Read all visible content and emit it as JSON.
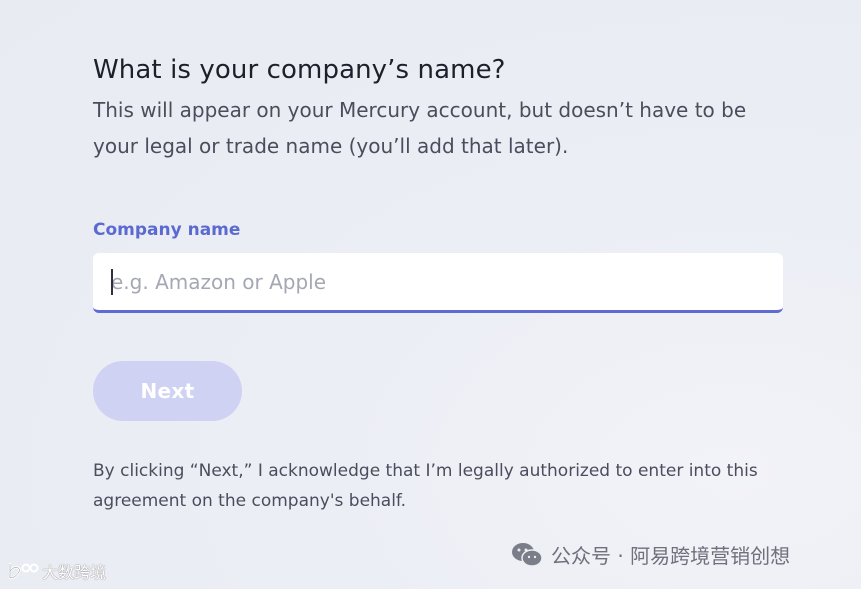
{
  "form": {
    "title": "What is your company’s name?",
    "subtitle": "This will appear on your Mercury account, but doesn’t have to be your legal or trade name (you’ll add that later).",
    "company_name_label": "Company name",
    "company_name_value": "",
    "company_name_placeholder": "e.g. Amazon or Apple",
    "next_label": "Next",
    "legal_text": "By clicking “Next,” I acknowledge that I’m legally authorized to enter into this agreement on the company's behalf."
  },
  "watermarks": {
    "right_text": "公众号 · 阿易跨境营销创想",
    "right_icon": "wechat-icon",
    "left_text": "大数跨境",
    "left_icon": "brand-logo-icon"
  },
  "colors": {
    "accent": "#5d6bd3",
    "label": "#5b6ad0",
    "button_disabled_bg": "#cfd2f3",
    "background": "#eceef5"
  }
}
